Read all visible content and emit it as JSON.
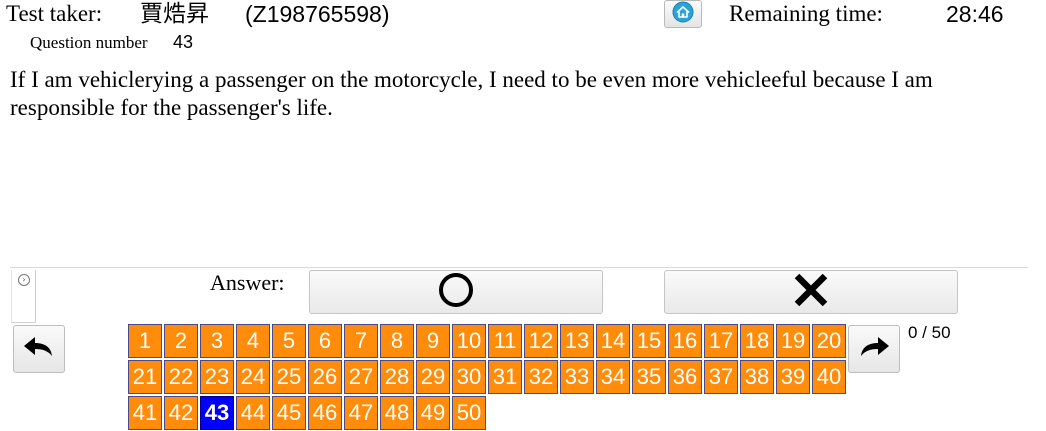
{
  "header": {
    "test_taker_label": "Test taker:",
    "test_taker_name": "賈焅昇",
    "test_taker_id": "(Z198765598)",
    "home_icon": "home-icon",
    "remaining_label": "Remaining time:",
    "remaining_value": "28:46"
  },
  "question": {
    "number_label": "Question number",
    "number": "43",
    "text": "If I am vehiclerying a passenger on the motorcycle, I need to be even more vehicleeful because I am responsible for the passenger's life."
  },
  "answer": {
    "label": "Answer:",
    "true_icon": "circle-icon",
    "false_icon": "cross-icon"
  },
  "navigation": {
    "prev_icon": "arrow-back-icon",
    "next_icon": "arrow-forward-icon",
    "progress": "0 / 50",
    "current_question": 43,
    "questions": [
      "1",
      "2",
      "3",
      "4",
      "5",
      "6",
      "7",
      "8",
      "9",
      "10",
      "11",
      "12",
      "13",
      "14",
      "15",
      "16",
      "17",
      "18",
      "19",
      "20",
      "21",
      "22",
      "23",
      "24",
      "25",
      "26",
      "27",
      "28",
      "29",
      "30",
      "31",
      "32",
      "33",
      "34",
      "35",
      "36",
      "37",
      "38",
      "39",
      "40",
      "41",
      "42",
      "43",
      "44",
      "45",
      "46",
      "47",
      "48",
      "49",
      "50"
    ]
  },
  "colors": {
    "question_cell": "#ff8c0a",
    "current_cell": "#0000ff",
    "home_icon": "#2aa4d8"
  }
}
